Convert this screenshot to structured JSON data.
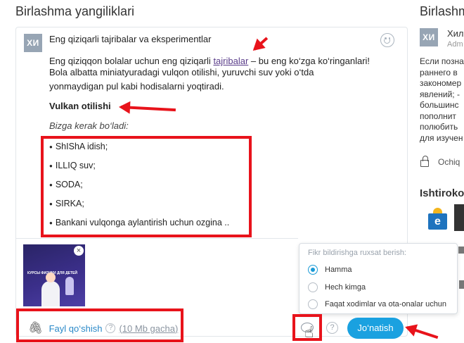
{
  "header": {
    "title": "Birlashma yangiliklari",
    "side_title": "Birlashm"
  },
  "post": {
    "avatar": "ХИ",
    "title": "Eng qiziqarli tajribalar va eksperimentlar",
    "intro_before": "Eng qiziqqon bolalar uchun eng qiziqarli ",
    "intro_link": "tajribalar",
    "intro_after": " – bu eng ko‘zga ko‘ringanlari!",
    "intro_line2": "Bola albatta miniatyuradagi vulqon otilishi, yuruvchi suv yoki o‘tda",
    "intro_line3": "yonmaydigan pul kabi hodisalarni yoqtiradi.",
    "section_title": "Vulkan otilishi",
    "needs_label": "Bizga kerak bo‘ladi:",
    "items": [
      "ShIShA idish;",
      "ILLIQ suv;",
      "SODA;",
      "SIRKA;",
      "Bankani vulqonga aylantirish uchun ozgina .."
    ]
  },
  "attachment": {
    "thumb_text": "КУРСЫ ФИЗИКИ ДЛЯ ДЕТЕЙ",
    "thumb_close": "×"
  },
  "footer": {
    "attach_label": "Fayl qo‘shish",
    "help": "?",
    "size_limit": "(10 Mb gacha)",
    "send_label": "Jo‘natish"
  },
  "comments_popup": {
    "title": "Fikr bildirishga ruxsat berish:",
    "options": [
      "Hamma",
      "Hech kimga",
      "Faqat xodimlar va ota-onalar uchun"
    ],
    "selected_index": 0
  },
  "sidebar": {
    "avatar": "ХИ",
    "author": "Хил",
    "role": "Adm",
    "text_lines": [
      "Если позна",
      "раннего в",
      "закономер",
      "явлений; -",
      "большинс",
      "пополнит",
      "полюбить",
      "для изучен"
    ],
    "open_label": "Ochiq",
    "participants_title": "Ishtiroko",
    "logo_letter": "e"
  },
  "colors": {
    "accent": "#1aa1e0",
    "link": "#5a3d8a",
    "annotation": "#e8131b"
  }
}
